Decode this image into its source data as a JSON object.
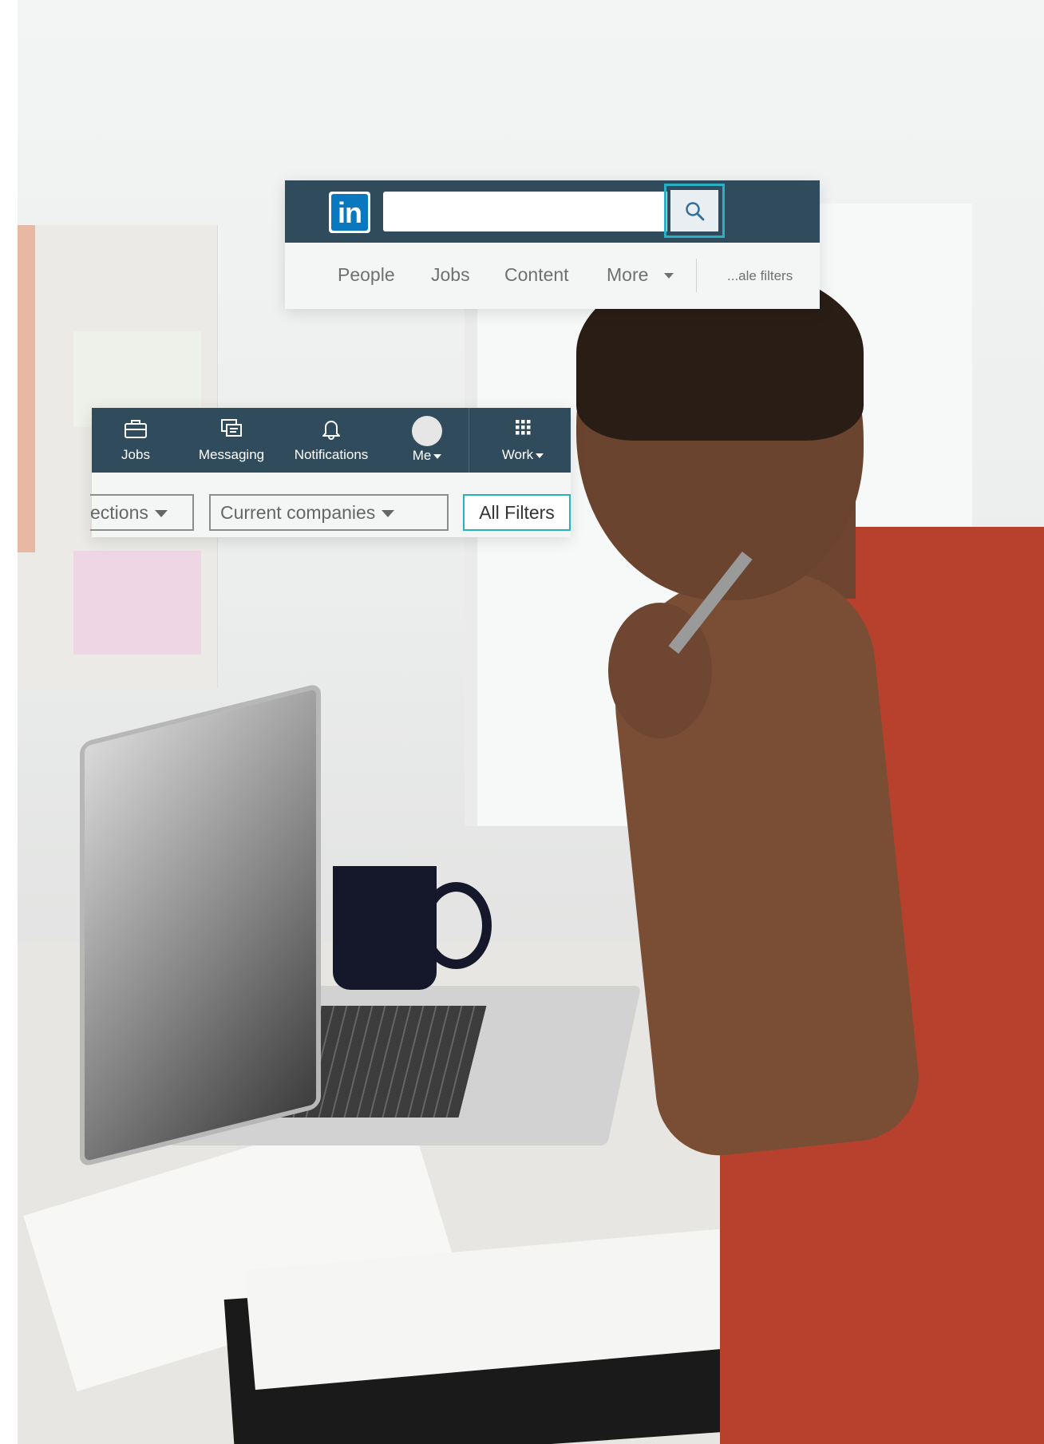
{
  "search_bar": {
    "logo_text": "in",
    "search_value": "",
    "tabs": [
      "People",
      "Jobs",
      "Content",
      "More"
    ],
    "filters_label": "...ale filters"
  },
  "nav_bar": {
    "items": [
      {
        "label": "Jobs",
        "icon": "briefcase-icon"
      },
      {
        "label": "Messaging",
        "icon": "messaging-icon"
      },
      {
        "label": "Notifications",
        "icon": "bell-icon"
      },
      {
        "label": "Me",
        "icon": "avatar"
      },
      {
        "label": "Work",
        "icon": "grid-icon"
      }
    ],
    "filters": {
      "connections_label": "ections",
      "current_companies_label": "Current companies",
      "all_filters_label": "All Filters"
    }
  },
  "colors": {
    "nav_background": "#2f4b5c",
    "accent": "#2ab0c5",
    "logo_blue": "#0a78bf"
  }
}
